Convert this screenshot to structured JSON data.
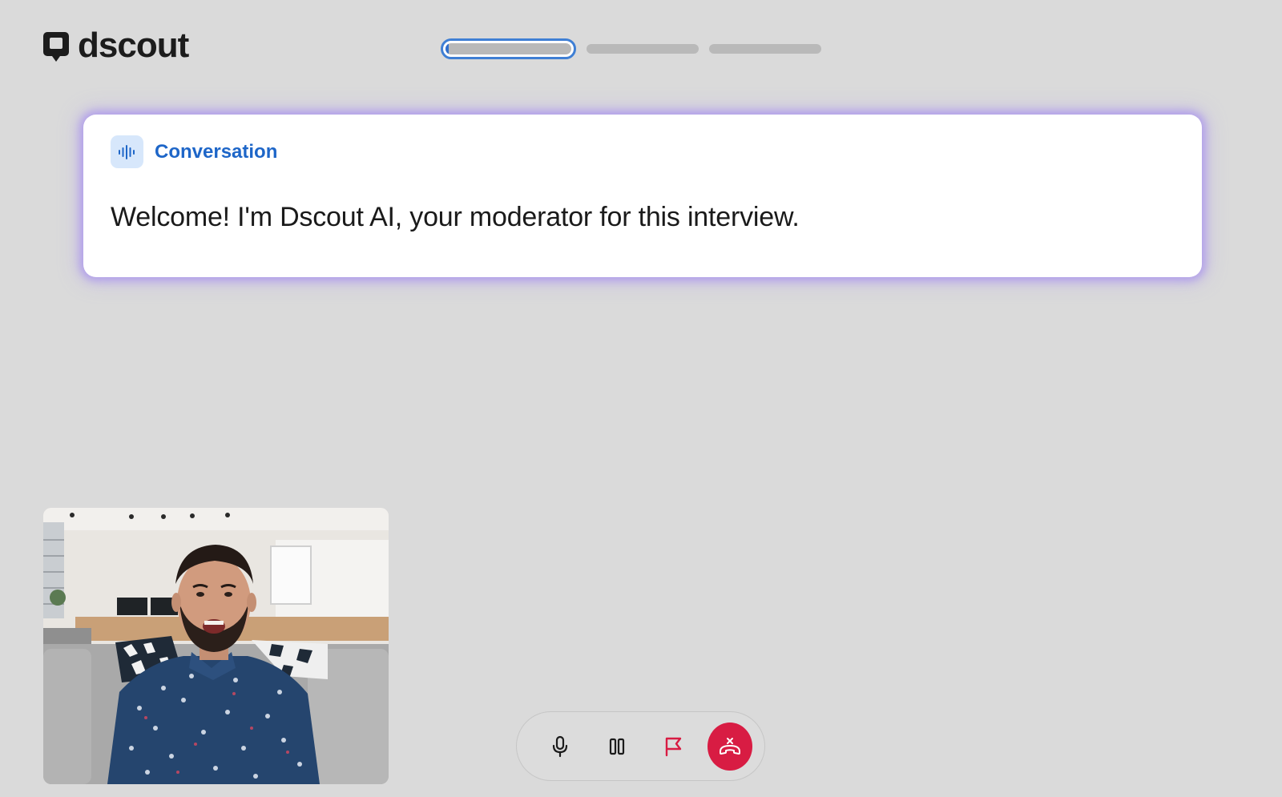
{
  "brand": {
    "name": "dscout"
  },
  "progress": {
    "steps": 3,
    "current_step": 1,
    "current_step_fill": 0.02,
    "colors": {
      "active_border": "#3f7fd4",
      "inactive": "#b9b9b9"
    }
  },
  "conversation_card": {
    "icon": "audio-waveform-icon",
    "label": "Conversation",
    "message": "Welcome! I'm Dscout AI, your moderator for this interview.",
    "accent_color": "#1e66c8",
    "glow_color": "#9d82f0"
  },
  "camera_preview": {
    "subject": "participant self-view"
  },
  "controls": {
    "items": [
      {
        "name": "microphone",
        "icon": "microphone-icon"
      },
      {
        "name": "pause",
        "icon": "pause-icon"
      },
      {
        "name": "flag",
        "icon": "flag-icon",
        "color": "#d81c43"
      },
      {
        "name": "end-call",
        "icon": "hang-up-icon",
        "color": "#d81c43"
      }
    ]
  }
}
